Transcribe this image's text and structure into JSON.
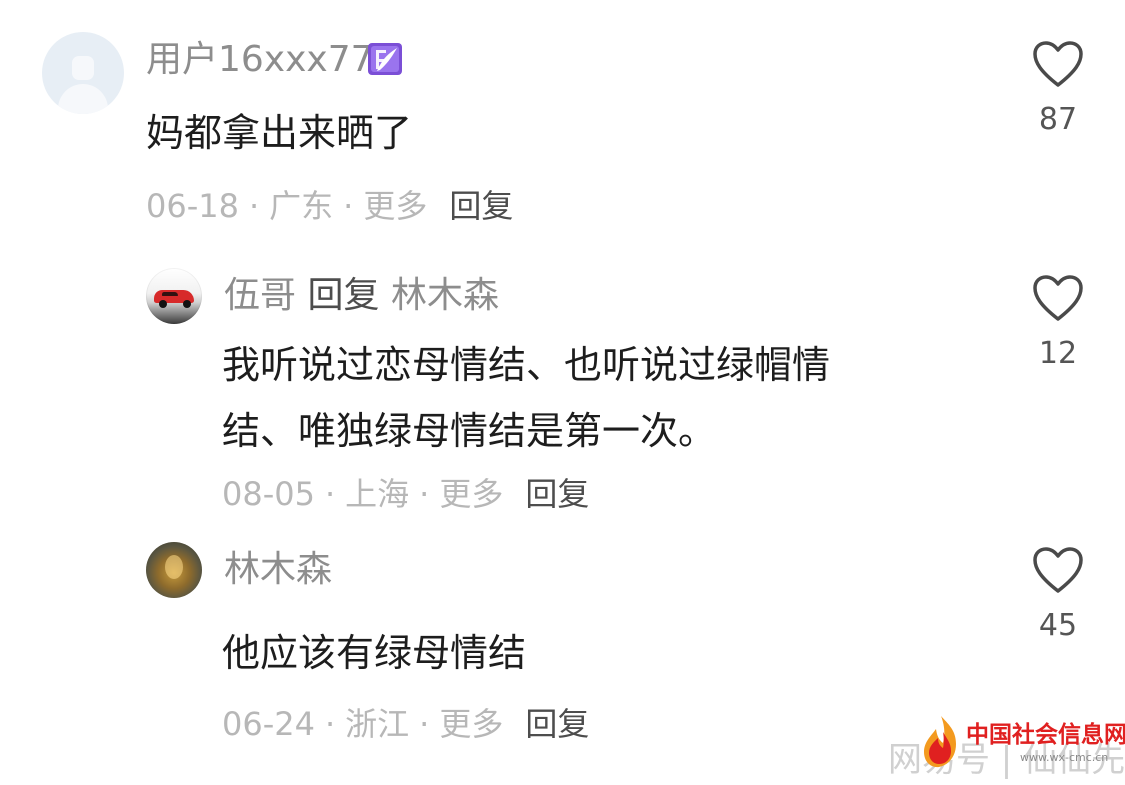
{
  "comments": [
    {
      "username": "用户16xxx77",
      "badge_icon": "purple-feather-badge-icon",
      "text_lines": [
        "妈都拿出来晒了"
      ],
      "date": "06-18",
      "location": "广东",
      "more": "更多",
      "reply": "回复",
      "likes": "87",
      "avatar": "default-user-avatar"
    },
    {
      "username": "伍哥",
      "reply_word": "回复",
      "reply_to": "林木森",
      "text_lines": [
        "我听说过恋母情结、也听说过绿帽情",
        "结、唯独绿母情结是第一次。"
      ],
      "date": "08-05",
      "location": "上海",
      "more": "更多",
      "reply": "回复",
      "likes": "12",
      "avatar": "red-car-avatar"
    },
    {
      "username": "林木森",
      "text_lines": [
        "他应该有绿母情结"
      ],
      "date": "06-24",
      "location": "浙江",
      "more": "更多",
      "reply": "回复",
      "likes": "45",
      "avatar": "painting-avatar"
    }
  ],
  "watermark": {
    "title": "中国社会信息网",
    "url": "www.wx-cmc.cn",
    "faded_text": "网易号 | 仙仙先生"
  },
  "colors": {
    "username": "#8d8d8d",
    "body_text": "#1d1d1d",
    "meta": "#b7b7b7",
    "reply_button": "#4d4d4d",
    "like_count": "#555555",
    "badge": "#7b4fd6",
    "watermark_red": "#e02020",
    "watermark_orange": "#f39a1f"
  }
}
